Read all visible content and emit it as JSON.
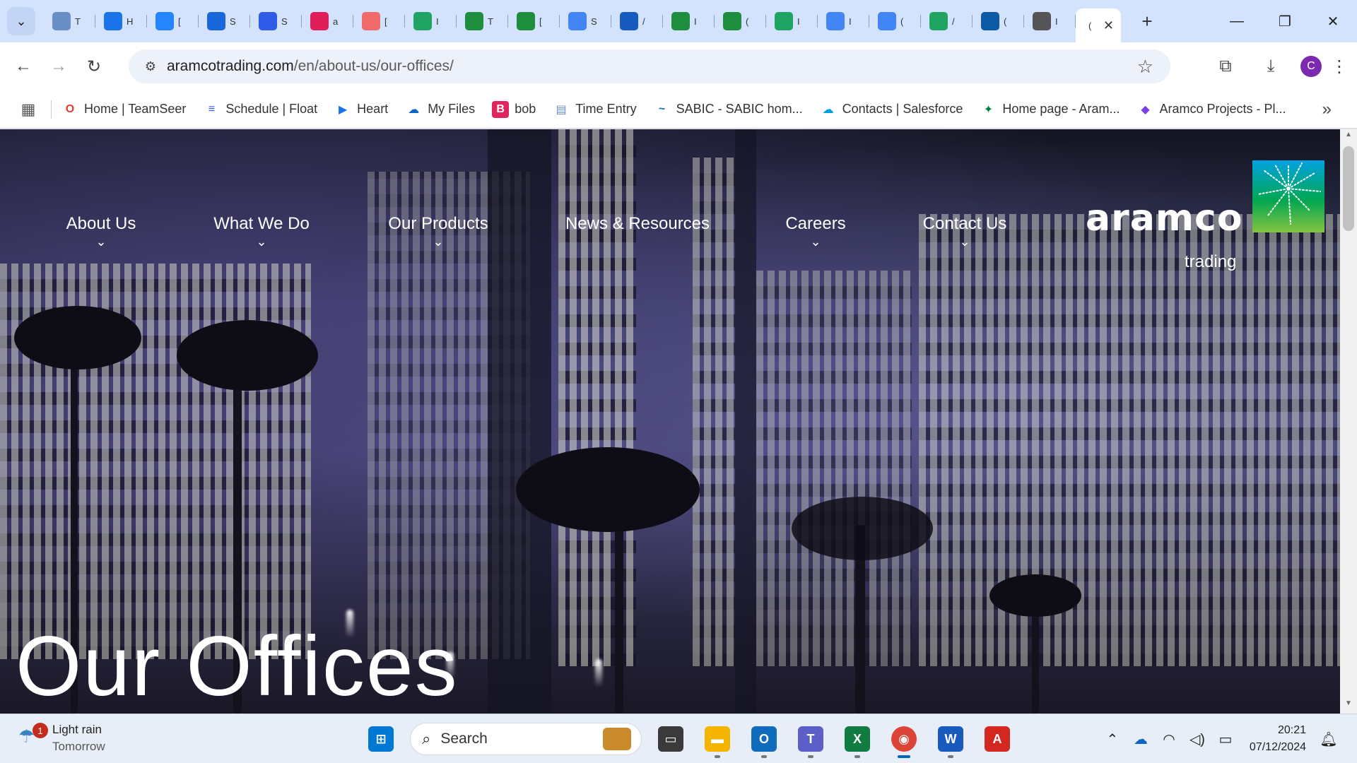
{
  "browser": {
    "tabs": [
      {
        "icon": "time-entry-icon",
        "label": "T",
        "color": "#6a8fc7"
      },
      {
        "icon": "heart-icon",
        "label": "H",
        "color": "#1a73e8"
      },
      {
        "icon": "jira-icon",
        "label": "[",
        "color": "#2684ff"
      },
      {
        "icon": "confluence-icon",
        "label": "S",
        "color": "#1868db"
      },
      {
        "icon": "float-icon",
        "label": "S",
        "color": "#2e5ce6"
      },
      {
        "icon": "slack-icon",
        "label": "a",
        "color": "#e01e5a"
      },
      {
        "icon": "asana-icon",
        "label": "[",
        "color": "#f06a6a"
      },
      {
        "icon": "drive-icon",
        "label": "I",
        "color": "#1fa463"
      },
      {
        "icon": "sheets-icon",
        "label": "T",
        "color": "#1e8e3e"
      },
      {
        "icon": "sheets-icon",
        "label": "[",
        "color": "#1e8e3e"
      },
      {
        "icon": "docs-icon",
        "label": "S",
        "color": "#4285f4"
      },
      {
        "icon": "word-icon",
        "label": "/",
        "color": "#185abd"
      },
      {
        "icon": "sheets-icon",
        "label": "I",
        "color": "#1e8e3e"
      },
      {
        "icon": "sheets-icon",
        "label": "(",
        "color": "#1e8e3e"
      },
      {
        "icon": "drive-icon",
        "label": "I",
        "color": "#1fa463"
      },
      {
        "icon": "docs-icon",
        "label": "I",
        "color": "#4285f4"
      },
      {
        "icon": "docs-icon",
        "label": "(",
        "color": "#4285f4"
      },
      {
        "icon": "drive-icon",
        "label": "/",
        "color": "#1fa463"
      },
      {
        "icon": "edge-icon",
        "label": "(",
        "color": "#0c59a4"
      },
      {
        "icon": "chrome-icon",
        "label": "I",
        "color": "#555555"
      }
    ],
    "active_tab": {
      "label": "(",
      "close": "✕"
    },
    "new_tab": "+",
    "window_controls": {
      "minimize": "—",
      "restore": "❐",
      "close": "✕"
    },
    "url_host": "aramcotrading.com",
    "url_path": "/en/about-us/our-offices/",
    "avatar_letter": "C",
    "bookmarks": [
      {
        "label": "Home | TeamSeer",
        "icon": "teamseer-icon",
        "color": "#e53935"
      },
      {
        "label": "Schedule | Float",
        "icon": "float-icon",
        "color": "#2e5ce6"
      },
      {
        "label": "Heart",
        "icon": "heart-icon",
        "color": "#1a73e8"
      },
      {
        "label": "My Files",
        "icon": "onedrive-icon",
        "color": "#0a66c2"
      },
      {
        "label": "bob",
        "icon": "bob-icon",
        "color": "#e0245e"
      },
      {
        "label": "Time Entry",
        "icon": "time-entry-icon",
        "color": "#6a8fc7"
      },
      {
        "label": "SABIC - SABIC hom...",
        "icon": "sabic-icon",
        "color": "#0b6fb8"
      },
      {
        "label": "Contacts | Salesforce",
        "icon": "salesforce-icon",
        "color": "#00a1e0"
      },
      {
        "label": "Home page - Aram...",
        "icon": "aramco-icon",
        "color": "#00843d"
      },
      {
        "label": "Aramco Projects - Pl...",
        "icon": "planner-icon",
        "color": "#7b3fe4"
      }
    ]
  },
  "site": {
    "nav": [
      {
        "label": "About Us",
        "chevron": true
      },
      {
        "label": "What We Do",
        "chevron": true
      },
      {
        "label": "Our Products",
        "chevron": true
      },
      {
        "label": "News & Resources",
        "chevron": false
      },
      {
        "label": "Careers",
        "chevron": true
      },
      {
        "label": "Contact Us",
        "chevron": true
      }
    ],
    "logo_word": "aramco",
    "logo_sub": "trading",
    "hero_title": "Our Offices",
    "brand_colors": {
      "green": "#00a651",
      "blue": "#0072bc"
    }
  },
  "taskbar": {
    "weather_badge": "1",
    "weather_title": "Light rain",
    "weather_sub": "Tomorrow",
    "search_placeholder": "Search",
    "time": "20:21",
    "date": "07/12/2024",
    "apps": [
      {
        "name": "start-button",
        "icon": "windows-icon",
        "color": "#0078d4",
        "glyph": "⊞"
      },
      {
        "name": "search",
        "icon": "search-icon"
      },
      {
        "name": "file-manager",
        "icon": "task-view-icon",
        "color": "#333333",
        "glyph": "▭"
      },
      {
        "name": "file-explorer",
        "icon": "folder-icon",
        "color": "#f4b400",
        "glyph": "▬"
      },
      {
        "name": "outlook",
        "icon": "outlook-icon",
        "color": "#0f6cbd",
        "glyph": "O"
      },
      {
        "name": "teams",
        "icon": "teams-icon",
        "color": "#5b5fc7",
        "glyph": "T"
      },
      {
        "name": "excel",
        "icon": "excel-icon",
        "color": "#107c41",
        "glyph": "X"
      },
      {
        "name": "chrome",
        "icon": "chrome-icon",
        "color": "#db4437",
        "glyph": "◉"
      },
      {
        "name": "word",
        "icon": "word-icon",
        "color": "#185abd",
        "glyph": "W"
      },
      {
        "name": "acrobat",
        "icon": "pdf-icon",
        "color": "#d4271f",
        "glyph": "A"
      }
    ]
  }
}
